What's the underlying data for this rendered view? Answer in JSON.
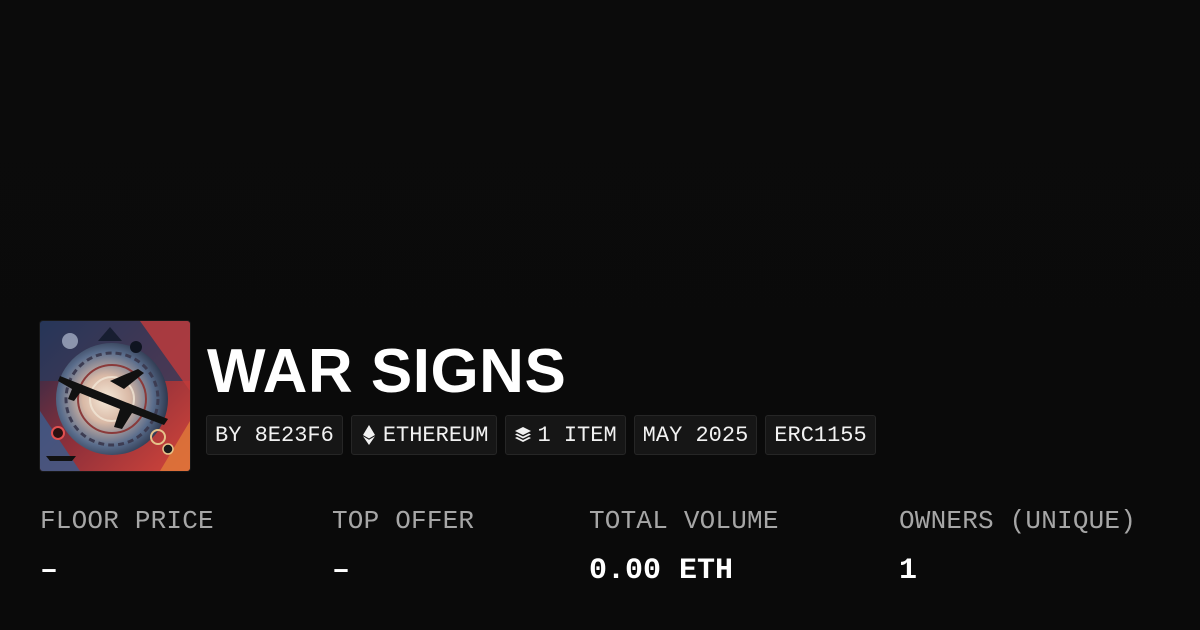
{
  "collection": {
    "title": "WAR SIGNS",
    "thumbnail_icon": "war-signs-collection-artwork"
  },
  "tags": [
    {
      "label": "BY 8E23F6",
      "icon": null
    },
    {
      "label": "ETHEREUM",
      "icon": "ethereum-icon"
    },
    {
      "label": "1 ITEM",
      "icon": "layers-icon"
    },
    {
      "label": "MAY 2025",
      "icon": null
    },
    {
      "label": "ERC1155",
      "icon": null
    }
  ],
  "stats": [
    {
      "label": "FLOOR PRICE",
      "value": "–"
    },
    {
      "label": "TOP OFFER",
      "value": "–"
    },
    {
      "label": "TOTAL VOLUME",
      "value": "0.00 ETH"
    },
    {
      "label": "OWNERS (UNIQUE)",
      "value": "1"
    }
  ],
  "colors": {
    "background": "#0b0b0b",
    "tag_background": "#161616",
    "tag_border": "#262626",
    "label_gray": "#a6a6a6",
    "text_white": "#ffffff"
  }
}
